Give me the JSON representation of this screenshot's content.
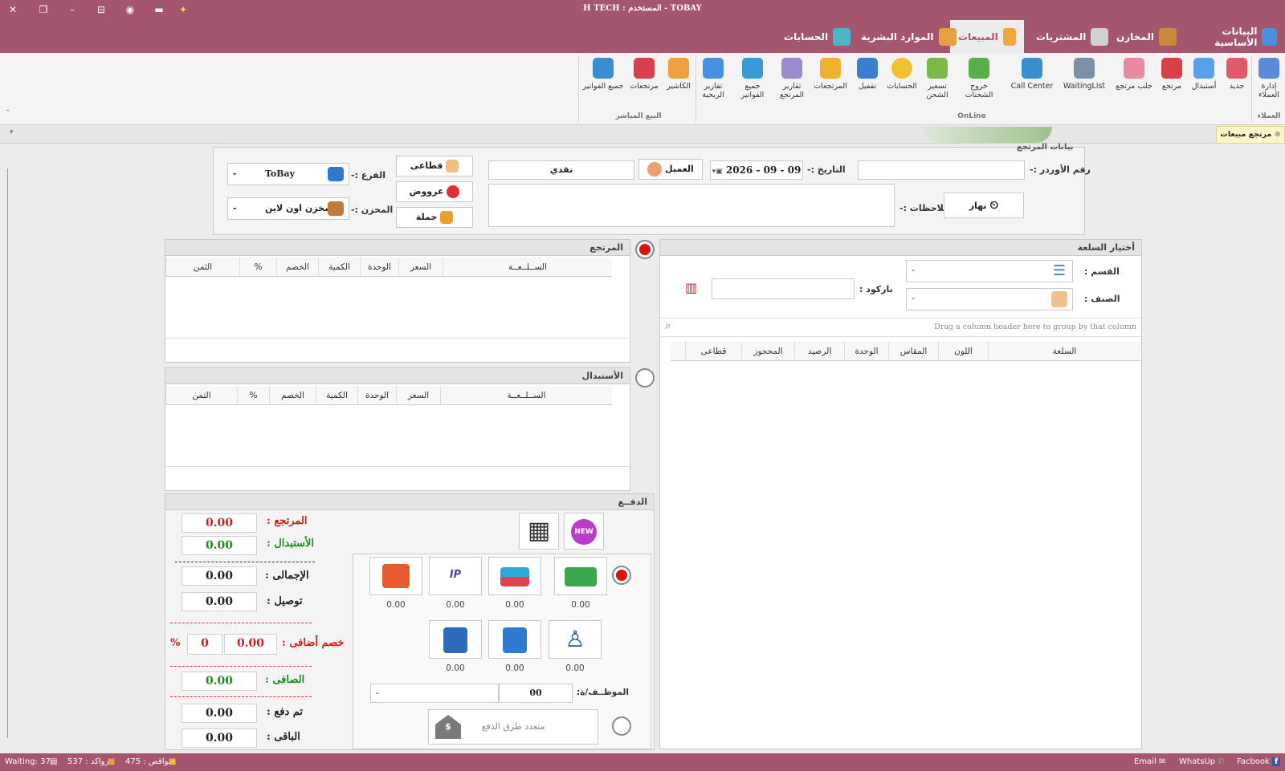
{
  "title_bar": {
    "title": "H TECH : المستخدم   -   TOBAY"
  },
  "tabs": [
    {
      "label": "البيانات الأساسية"
    },
    {
      "label": "المخازن"
    },
    {
      "label": "المشتريات"
    },
    {
      "label": "المبيعات",
      "active": true
    },
    {
      "label": "الموارد البشرية"
    },
    {
      "label": "الحسابات"
    }
  ],
  "ribbon": {
    "groups": {
      "customers": "العملاء",
      "online": "OnLine",
      "direct": "البيع المباشر"
    },
    "buttons": {
      "customers_mgmt": "إدارة العملاء",
      "new": "جديد",
      "exchange": "أستبدال",
      "return": "مرتجع",
      "fetch_return": "جلب مرتجع",
      "waiting": "WaitingList",
      "call_center": "Call Center",
      "ship_out": "خروج الشحنات",
      "ship_price": "تسعير الشحن",
      "accounts": "الحسابات",
      "close": "تقفيل",
      "returns": "المرتجعات",
      "return_reports": "تقارير المرتجع",
      "all_invoices": "جميع الفواتير",
      "profit_reports": "تقارير الربحية",
      "cashier": "الكاشير",
      "returns2": "مرتجعات",
      "all_invoices2": "جميع الفواتير"
    }
  },
  "doc_tab": {
    "label": "مرتجع مبيعات"
  },
  "header_form": {
    "section_title": "بيانات المرتجع",
    "order_no_label": "رقم الأوردر :-",
    "date_label": "التاريخ :-",
    "date_value": "2026 - 09 - 09",
    "customer_button": "العميل",
    "customer_value": "نقدي",
    "notes_label": "ملاحظات :-",
    "shift_value": "نهار",
    "btn_retail": "قطاعى",
    "btn_offers": "عرووض",
    "btn_wholesale": "جملة",
    "branch_label": "الفرع :-",
    "branch_value": "ToBay",
    "store_label": "المخزن :-",
    "store_value": "مخزن اون لاين",
    "dash": "-"
  },
  "item_select": {
    "title": "أختيار السلعة",
    "category_label": "القسم :",
    "type_label": "الصنف :",
    "barcode_label": "باركود :",
    "group_hint": "Drag a column header here to group by that column",
    "columns": [
      "السلعة",
      "اللون",
      "المقاس",
      "الوحدة",
      "الرصيد",
      "المحجوز",
      "قطاعى"
    ]
  },
  "return_grid": {
    "title": "المرتجع",
    "columns": [
      "الســلــعــة",
      "السعر",
      "الوحدة",
      "الكمية",
      "الخصم",
      "%",
      "الثمن"
    ]
  },
  "exchange_grid": {
    "title": "الأستبدال",
    "columns": [
      "الســلــعــة",
      "السعر",
      "الوحدة",
      "الكمية",
      "الخصم",
      "%",
      "الثمن"
    ]
  },
  "payment": {
    "title": "الدفــع",
    "returned_label": "المرتجع :",
    "returned_value": "0.00",
    "exchange_label": "الأستبدال :",
    "exchange_value": "0.00",
    "total_label": "الإجمالى :",
    "total_value": "0.00",
    "delivery_label": "توصيل :",
    "delivery_value": "0.00",
    "extra_discount_label": "خصم أضافى :",
    "extra_discount_value": "0.00",
    "extra_discount_pct": "0",
    "pct_sign": "%",
    "net_label": "الصافى :",
    "net_value": "0.00",
    "paid_label": "تم دفع :",
    "paid_value": "0.00",
    "remaining_label": "الباقى :",
    "remaining_value": "0.00",
    "new_badge": "NEW",
    "method_values": [
      "0.00",
      "0.00",
      "0.00",
      "0.00"
    ],
    "method_values2": [
      "0.00",
      "0.00",
      "0.00"
    ],
    "employee_label": "الموظــف/ة:",
    "employee_code": "00",
    "multi_pay": "متعدد طرق الدفع"
  },
  "status_bar": {
    "waiting": "Waiting: 37",
    "stagnant": "رواكد : 537",
    "shortages": "نواقص : 475",
    "email": "Email",
    "whatsapp": "WhatsUp",
    "facebook": "Facbook"
  }
}
